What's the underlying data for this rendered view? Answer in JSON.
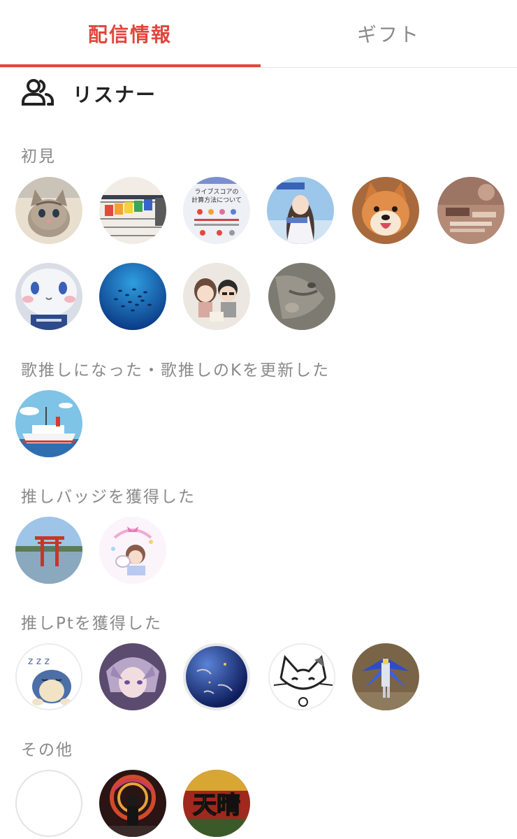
{
  "tabs": {
    "active_label": "配信情報",
    "other_label": "ギフト"
  },
  "section": {
    "icon": "users-icon",
    "title": "リスナー"
  },
  "groups": [
    {
      "label": "初見",
      "avatars": [
        "kitten",
        "guitar-frets",
        "live-score-info",
        "anime-girl",
        "shiba-dog",
        "sepia-photo",
        "plush-rabbit",
        "fish-school",
        "chibi-couple",
        "grey-cat"
      ]
    },
    {
      "label": "歌推しになった・歌推しのKを更新した",
      "avatars": [
        "ferry-ship"
      ]
    },
    {
      "label": "推しバッジを獲得した",
      "avatars": [
        "torii-gate",
        "pastel-anime"
      ]
    },
    {
      "label": "推しPtを獲得した",
      "avatars": [
        "sleeping-snorlax",
        "purple-anime-boy",
        "lapis-sphere",
        "cat-sketch",
        "gundam-model"
      ]
    },
    {
      "label": "その他",
      "avatars": [
        "blank-avatar",
        "dark-figure",
        "tenbare"
      ]
    }
  ],
  "avatar_texts": {
    "live_score_line1": "ライブスコアの",
    "live_score_line2": "計算方法について",
    "tenbare": "天晴"
  },
  "colors": {
    "accent": "#e0473c",
    "muted": "#8a8a8a",
    "divider": "#e6e6e6"
  }
}
